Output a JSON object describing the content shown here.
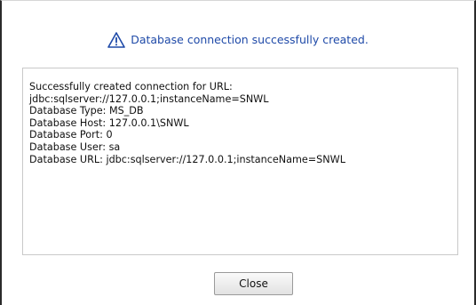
{
  "dialog": {
    "header": {
      "icon": "warning-triangle-icon",
      "message": "Database connection successfully created.",
      "message_color": "#1f4aa8"
    },
    "details": [
      "Successfully created connection for URL:",
      "jdbc:sqlserver://127.0.0.1;instanceName=SNWL",
      "Database Type: MS_DB",
      "Database Host: 127.0.0.1\\SNWL",
      "Database Port: 0",
      "Database User: sa",
      "Database URL: jdbc:sqlserver://127.0.0.1;instanceName=SNWL"
    ],
    "close_label": "Close"
  }
}
